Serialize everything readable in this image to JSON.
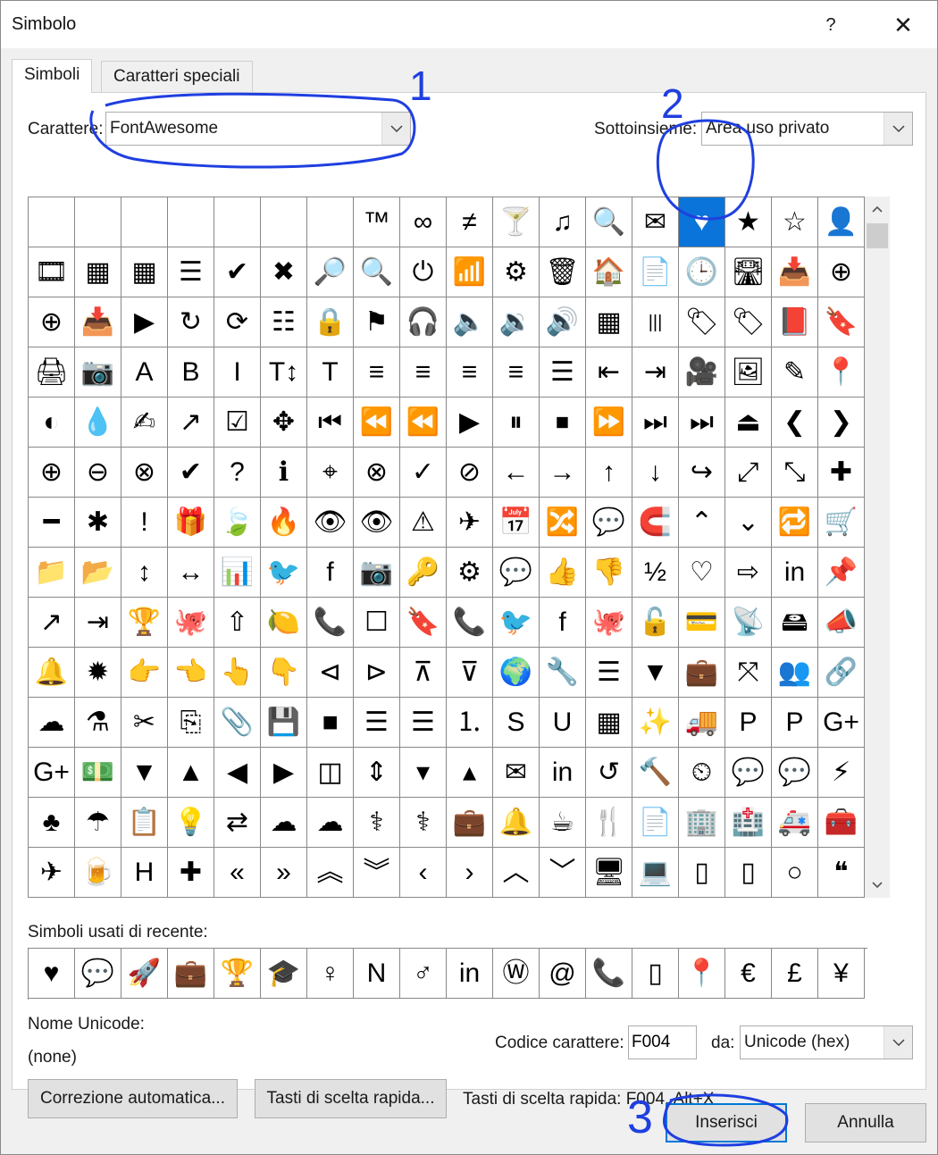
{
  "window": {
    "title": "Simbolo",
    "help": "?",
    "close": "✕"
  },
  "tabs": [
    {
      "label": "Simboli",
      "active": true
    },
    {
      "label": "Caratteri speciali",
      "active": false
    }
  ],
  "font": {
    "label": "Carattere:",
    "value": "FontAwesome"
  },
  "subset": {
    "label": "Sottoinsieme:",
    "value": "Area uso privato"
  },
  "grid": {
    "selected_index": 14,
    "cells": [
      "",
      "",
      "",
      "",
      "",
      "",
      "",
      "™",
      "∞",
      "≠",
      "🍸",
      "♫",
      "🔍",
      "✉",
      "♥",
      "★",
      "☆",
      "👤",
      "🎞",
      "▦",
      "▦",
      "☰",
      "✔",
      "✖",
      "🔎",
      "🔍",
      "⏻",
      "📶",
      "⚙",
      "🗑",
      "🏠",
      "📄",
      "🕒",
      "🛣",
      "📥",
      "⊕",
      "⊕",
      "📥",
      "▶",
      "↻",
      "⟳",
      "☷",
      "🔒",
      "⚑",
      "🎧",
      "🔈",
      "🔉",
      "🔊",
      "▦",
      "|||",
      "🏷",
      "🏷",
      "📕",
      "🔖",
      "🖨",
      "📷",
      "A",
      "B",
      "I",
      "T↕",
      "T",
      "≡",
      "≡",
      "≡",
      "≡",
      "☰",
      "⇤",
      "⇥",
      "🎥",
      "🖼",
      "✎",
      "📍",
      "◐",
      "💧",
      "✍",
      "↗",
      "☑",
      "✥",
      "⏮",
      "⏪",
      "⏪",
      "▶",
      "⏸",
      "⏹",
      "⏩",
      "⏭",
      "⏭",
      "⏏",
      "❮",
      "❯",
      "⊕",
      "⊖",
      "⊗",
      "✔",
      "?",
      "ℹ",
      "⌖",
      "⊗",
      "✓",
      "⊘",
      "←",
      "→",
      "↑",
      "↓",
      "↪",
      "⤢",
      "⤡",
      "✚",
      "━",
      "✱",
      "!",
      "🎁",
      "🍃",
      "🔥",
      "👁",
      "👁",
      "⚠",
      "✈",
      "📅",
      "🔀",
      "💬",
      "🧲",
      "⌃",
      "⌄",
      "🔁",
      "🛒",
      "📁",
      "📂",
      "↕",
      "↔",
      "📊",
      "🐦",
      "f",
      "📷",
      "🔑",
      "⚙",
      "💬",
      "👍",
      "👎",
      "½",
      "♡",
      "⇨",
      "in",
      "📌",
      "↗",
      "⇥",
      "🏆",
      "🐙",
      "⇧",
      "🍋",
      "📞",
      "☐",
      "🔖",
      "📞",
      "🐦",
      "f",
      "🐙",
      "🔓",
      "💳",
      "📡",
      "🖴",
      "📣",
      "🔔",
      "✹",
      "👉",
      "👈",
      "👆",
      "👇",
      "⊲",
      "⊳",
      "⊼",
      "⊽",
      "🌍",
      "🔧",
      "☰",
      "▼",
      "💼",
      "⤧",
      "👥",
      "🔗",
      "☁",
      "⚗",
      "✂",
      "⎘",
      "📎",
      "💾",
      "■",
      "☰",
      "☰",
      "⒈",
      "S",
      "U",
      "▦",
      "✨",
      "🚚",
      "P",
      "P",
      "G+",
      "G+",
      "💵",
      "▼",
      "▲",
      "◀",
      "▶",
      "◫",
      "⇕",
      "▾",
      "▴",
      "✉",
      "in",
      "↺",
      "🔨",
      "⏲",
      "💬",
      "💬",
      "⚡",
      "♣",
      "☂",
      "📋",
      "💡",
      "⇄",
      "☁",
      "☁",
      "⚕",
      "⚕",
      "💼",
      "🔔",
      "☕",
      "🍴",
      "📄",
      "🏢",
      "🏥",
      "🚑",
      "🧰",
      "✈",
      "🍺",
      "H",
      "✚",
      "«",
      "»",
      "︽",
      "︾",
      "‹",
      "›",
      "︿",
      "﹀",
      "🖥",
      "💻",
      "▯",
      "▯",
      "○",
      "❝"
    ]
  },
  "recent": {
    "label": "Simboli usati di recente:",
    "symbols": [
      "♥",
      "💬",
      "🚀",
      "💼",
      "🏆",
      "🎓",
      "♀",
      "N",
      "♂",
      "in",
      "Ⓦ",
      "@",
      "📞",
      "▯",
      "📍",
      "€",
      "£",
      "¥"
    ]
  },
  "unicode_name": {
    "label": "Nome Unicode:",
    "value": "(none)"
  },
  "char_code": {
    "label": "Codice carattere:",
    "value": "F004"
  },
  "from": {
    "label": "da:",
    "value": "Unicode (hex)"
  },
  "buttons": {
    "autocorrect": "Correzione automatica...",
    "shortcut_keys": "Tasti di scelta rapida...",
    "insert": "Inserisci",
    "cancel": "Annulla"
  },
  "shortcut_info": "Tasti di scelta rapida: F004, Alt+X",
  "annotations": [
    "1",
    "2",
    "3"
  ],
  "colors": {
    "selection": "#0a74da",
    "annotation": "#1f3fe0",
    "default_button_border": "#0078d7"
  }
}
